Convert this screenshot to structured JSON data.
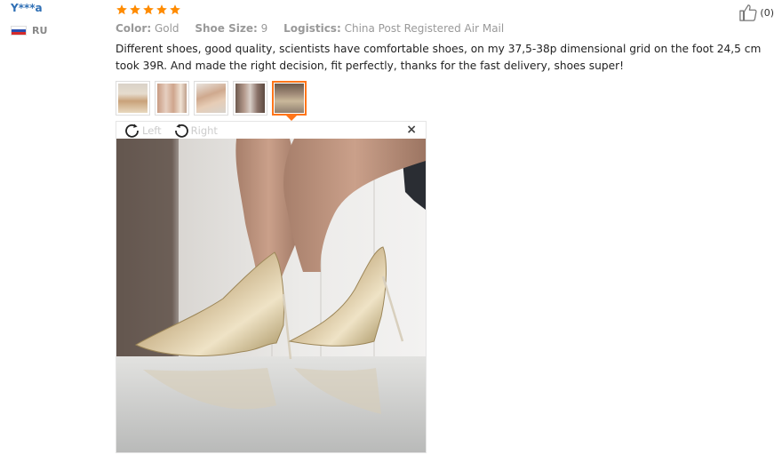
{
  "user": {
    "name": "Y***a",
    "country": "RU"
  },
  "review": {
    "rating": 5,
    "color_label": "Color:",
    "color_value": "Gold",
    "size_label": "Shoe Size:",
    "size_value": "9",
    "logistics_label": "Logistics:",
    "logistics_value": "China Post Registered Air Mail",
    "text": "Different shoes, good quality, scientists have comfortable shoes, on my 37,5-38p dimensional grid on the foot 24,5 cm took 39R. And made the right decision, fit perfectly, thanks for the fast delivery, shoes super!",
    "thumbnail_count": 5,
    "active_thumbnail": 5
  },
  "viewer": {
    "rotate_left_label": "Left",
    "rotate_right_label": "Right",
    "close_glyph": "×"
  },
  "like": {
    "count": "(0)"
  },
  "icons": {
    "rotate_left": "rotate-left-icon",
    "rotate_right": "rotate-right-icon",
    "close": "close-icon",
    "like": "thumbs-up-icon",
    "star": "star-icon",
    "flag": "flag-ru-icon"
  },
  "colors": {
    "username": "#2f6fb5",
    "star": "#ff8b00",
    "active_thumb": "#ff7519",
    "meta": "#999999"
  }
}
